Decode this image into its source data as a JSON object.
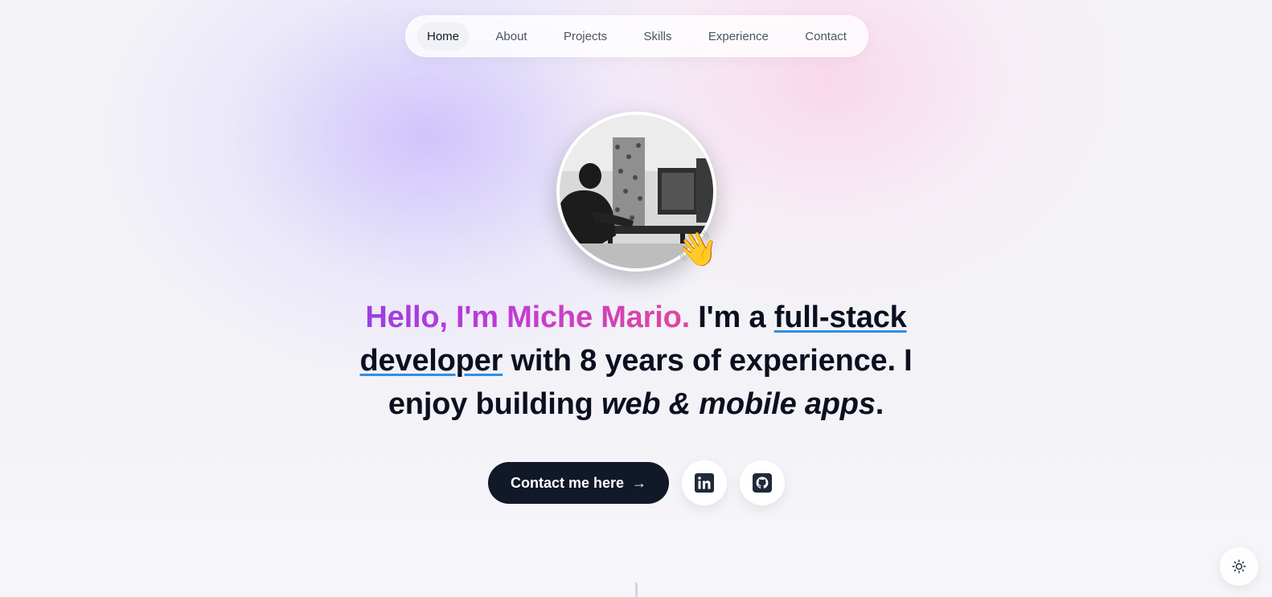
{
  "nav": {
    "items": [
      {
        "label": "Home",
        "active": true
      },
      {
        "label": "About"
      },
      {
        "label": "Projects"
      },
      {
        "label": "Skills"
      },
      {
        "label": "Experience"
      },
      {
        "label": "Contact"
      }
    ]
  },
  "hero": {
    "wave_emoji": "👋",
    "headline": {
      "greeting": "Hello, I'm Miche Mario.",
      "part1": " I'm a ",
      "role": "full-stack developer",
      "part2": " with 8 years of experience. I enjoy building ",
      "focus": "web & mobile apps",
      "end": "."
    },
    "cta_label": "Contact me here",
    "cta_arrow": "→"
  },
  "social": {
    "linkedin_icon": "linkedin-icon",
    "github_icon": "github-icon"
  },
  "theme_toggle_icon": "sun-icon",
  "colors": {
    "accent_gradient_start": "#9b3fe0",
    "accent_gradient_end": "#e2479a",
    "underline": "#2f8ee0",
    "button_dark": "#111827"
  }
}
